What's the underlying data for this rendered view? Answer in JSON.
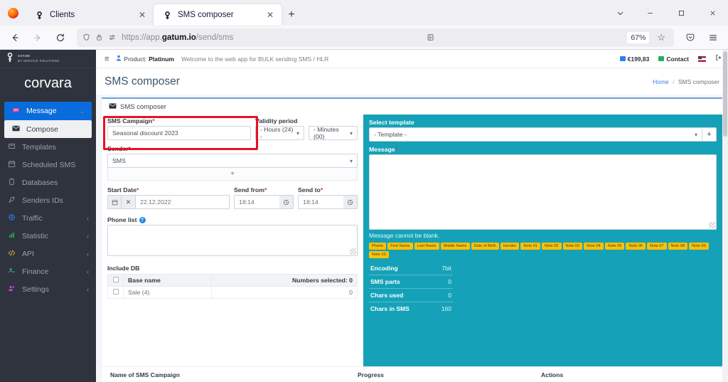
{
  "browser": {
    "tabs": [
      {
        "title": "Clients",
        "favicon": "gatum-icon",
        "active": false
      },
      {
        "title": "SMS composer",
        "favicon": "gatum-icon",
        "active": true
      }
    ],
    "new_tab_label": "+",
    "close_label": "✕",
    "window_controls": {
      "chevron": "⌄",
      "minimize": "─",
      "maximize": "❐",
      "close": "✕"
    },
    "nav": {
      "back": "←",
      "forward": "→",
      "reload": "⟳"
    },
    "url": {
      "prefix": "https://app.",
      "domain": "gatum.io",
      "path": "/send/sms"
    },
    "zoom_level": "67%",
    "icons": {
      "shield": "shield-icon",
      "lock": "lock-icon",
      "permissions": "permissions-icon",
      "reader": "reader-view-icon",
      "bookmark": "☆",
      "pocket": "pocket-icon",
      "menu": "≡"
    }
  },
  "sidebar": {
    "logo_mark": "Ʀ",
    "logo_line1": "GATUM",
    "logo_line2": "BY SERVICE SOLUTIONS",
    "brand": "corvara",
    "items": [
      {
        "label": "Message",
        "icon": "message-icon",
        "state": "active",
        "chevron": "⌄"
      },
      {
        "label": "Compose",
        "icon": "envelope-icon",
        "state": "sub",
        "chevron": ""
      },
      {
        "label": "Templates",
        "icon": "template-icon",
        "state": "normal",
        "chevron": ""
      },
      {
        "label": "Scheduled SMS",
        "icon": "calendar-icon",
        "state": "normal",
        "chevron": ""
      },
      {
        "label": "Databases",
        "icon": "database-icon",
        "state": "normal",
        "chevron": ""
      },
      {
        "label": "Senders IDs",
        "icon": "feather-icon",
        "state": "normal",
        "chevron": ""
      },
      {
        "label": "Traffic",
        "icon": "traffic-icon",
        "state": "normal",
        "chevron": "‹"
      },
      {
        "label": "Statistic",
        "icon": "chart-icon",
        "state": "normal",
        "chevron": "‹"
      },
      {
        "label": "API",
        "icon": "code-icon",
        "state": "normal",
        "chevron": "‹"
      },
      {
        "label": "Finance",
        "icon": "finance-icon",
        "state": "normal",
        "chevron": "‹"
      },
      {
        "label": "Settings",
        "icon": "settings-icon",
        "state": "normal",
        "chevron": "‹"
      }
    ]
  },
  "topbar": {
    "hamburger": "≡",
    "product_label": "Product:",
    "product_value": "Platinum",
    "welcome": "Welcome to the web app for BULK sending SMS / HLR",
    "balance": "€199,83",
    "contact": "Contact",
    "flag": "us-flag-icon",
    "logout": "⮌"
  },
  "page": {
    "title": "SMS composer",
    "breadcrumb_home": "Home",
    "breadcrumb_sep": "/",
    "breadcrumb_current": "SMS composer",
    "card_header": "SMS composer",
    "card_header_icon": "envelope-icon"
  },
  "form": {
    "campaign": {
      "label": "SMS Campaign",
      "required": "*",
      "value": "Seasonal discount 2023"
    },
    "validity": {
      "label": "Validity period",
      "hours": "- Hours (24) -",
      "minutes": "- Minutes (00)"
    },
    "sender": {
      "label": "Sender",
      "required": "*",
      "value": "SMS"
    },
    "add_sender": "+",
    "start_date": {
      "label": "Start Date",
      "required": "*",
      "value": "22.12.2022",
      "calendar_icon": "calendar-icon",
      "clear_icon": "✕"
    },
    "send_from": {
      "label": "Send from",
      "required": "*",
      "value": "18:14",
      "clock_icon": "clock-icon"
    },
    "send_to": {
      "label": "Send to",
      "required": "*",
      "value": "18:14",
      "clock_icon": "clock-icon"
    },
    "phone_list": {
      "label": "Phone list",
      "help_icon": "?",
      "value": ""
    },
    "include_db": {
      "label": "Include DB",
      "columns": [
        "",
        "Base name",
        "Numbers selected: 0"
      ],
      "rows": [
        {
          "name": "Sale (4)",
          "count": "0"
        }
      ]
    }
  },
  "right": {
    "select_template_label": "Select template",
    "template_value": "- Template -",
    "add_template": "+",
    "message_label": "Message",
    "message_required": "*",
    "message_value": "",
    "error": "Message cannot be blank.",
    "chips": [
      "Phone",
      "First Name",
      "Last Name",
      "Middle Name",
      "Date of Birth",
      "Gender",
      "Note 01",
      "Note 02",
      "Note 03",
      "Note 04",
      "Note 05",
      "Note 06",
      "Note 07",
      "Note 08",
      "Note 09",
      "Note 10"
    ],
    "stats": [
      {
        "key": "Encoding",
        "value": "7bit"
      },
      {
        "key": "SMS parts",
        "value": "0"
      },
      {
        "key": "Chars used",
        "value": "0"
      },
      {
        "key": "Chars in SMS",
        "value": "160"
      }
    ]
  },
  "bottom_table": {
    "col_name": "Name of SMS Campaign",
    "col_progress": "Progress",
    "col_actions": "Actions"
  },
  "colors": {
    "accent_teal": "#15a2b8",
    "sidebar_bg": "#2f333d",
    "active_blue": "#0a6cdc",
    "highlight_red": "#e81123",
    "chip_yellow": "#ffc107"
  }
}
